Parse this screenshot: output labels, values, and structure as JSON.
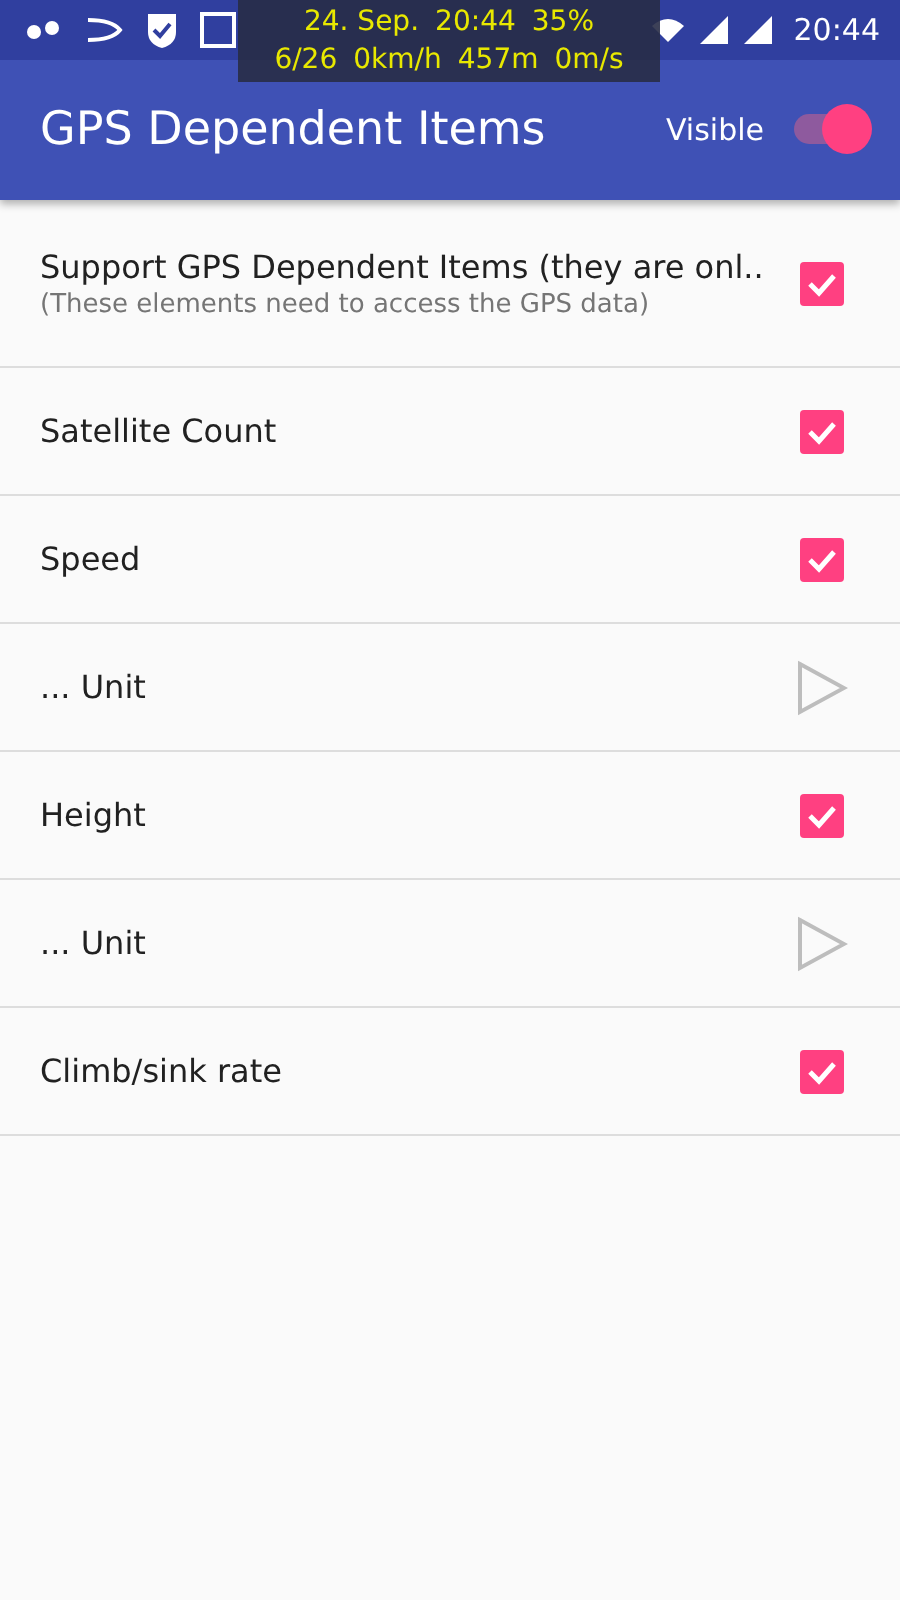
{
  "status_bar": {
    "time": "20:44",
    "overlay": {
      "date": "24. Sep.",
      "time": "20:44",
      "battery": "35%",
      "satellites": "6/26",
      "speed": "0km/h",
      "altitude": "457m",
      "climb": "0m/s"
    }
  },
  "app_bar": {
    "title": "GPS Dependent Items",
    "toggle": {
      "label": "Visible",
      "on": true
    }
  },
  "items": [
    {
      "kind": "checkbox",
      "title": "Support GPS Dependent Items (they are onl..",
      "summary": "(These elements need to access the GPS data)",
      "checked": true
    },
    {
      "kind": "checkbox",
      "title": "Satellite Count",
      "checked": true
    },
    {
      "kind": "checkbox",
      "title": "Speed",
      "checked": true
    },
    {
      "kind": "submenu",
      "title": "... Unit"
    },
    {
      "kind": "checkbox",
      "title": "Height",
      "checked": true
    },
    {
      "kind": "submenu",
      "title": "... Unit"
    },
    {
      "kind": "checkbox",
      "title": "Climb/sink rate",
      "checked": true
    }
  ]
}
